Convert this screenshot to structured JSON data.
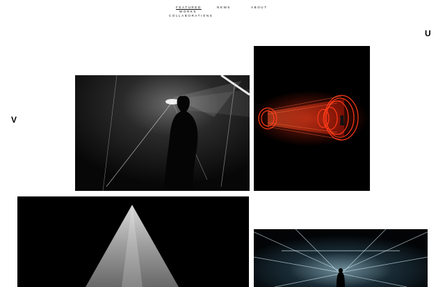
{
  "nav": {
    "featured": "FEATURED",
    "works": "WORKS",
    "collaborations": "COLLABORATIONS",
    "news": "NEWS",
    "about": "ABOUT"
  },
  "brand": {
    "letter_right": "U",
    "letter_left": "V"
  },
  "gallery": {
    "tiles": [
      {
        "subject": "silhouette-in-light-beams"
      },
      {
        "subject": "red-neon-rings"
      },
      {
        "subject": "light-triangle"
      },
      {
        "subject": "light-corridor-figure"
      }
    ]
  }
}
